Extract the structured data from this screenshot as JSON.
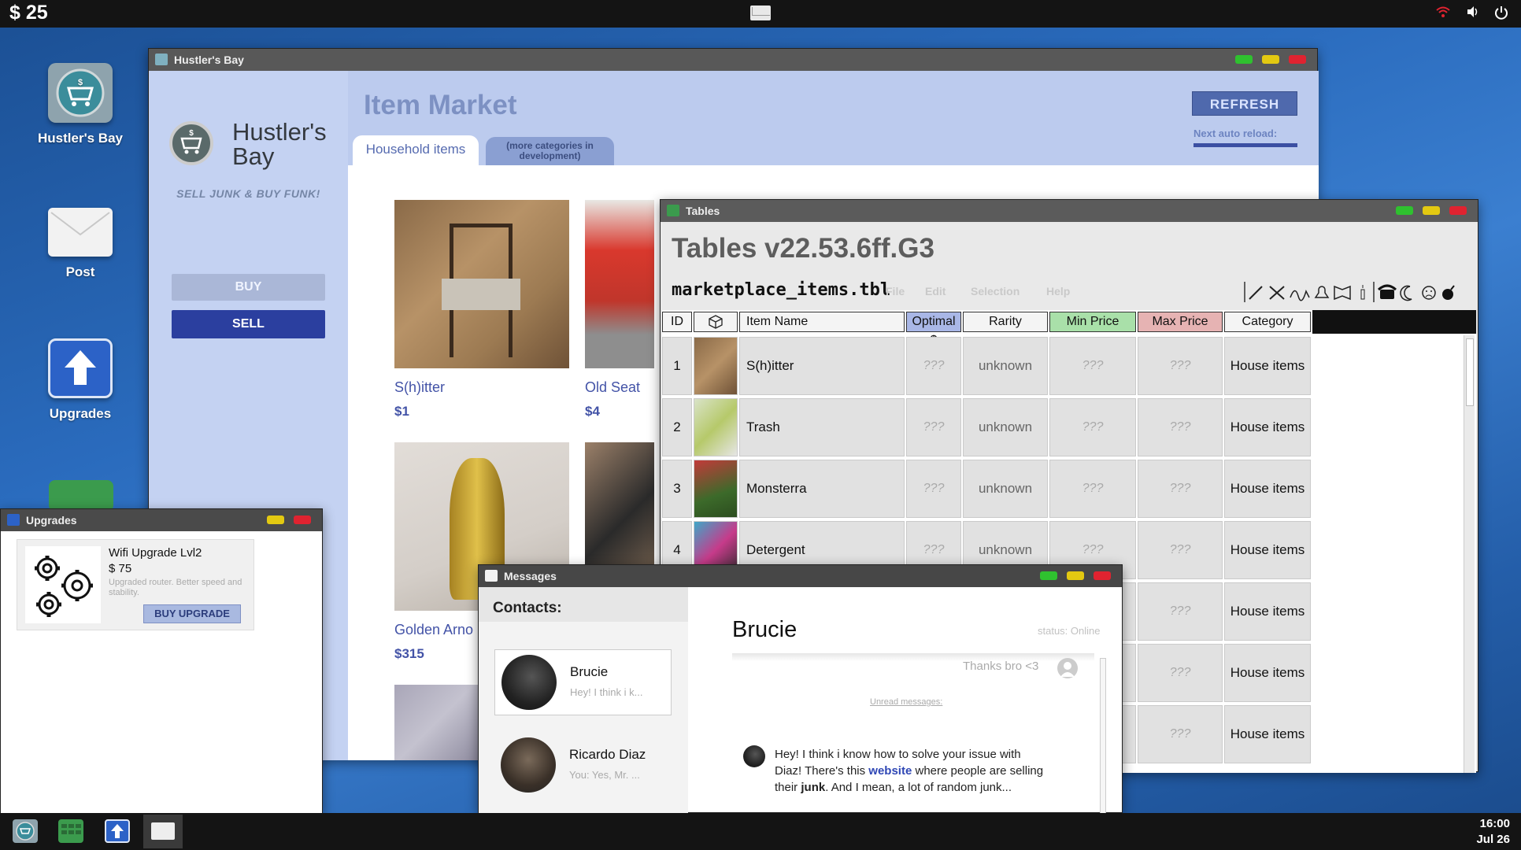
{
  "topbar": {
    "money": "$ 25",
    "icons": [
      "wifi-icon",
      "volume-icon",
      "power-icon"
    ]
  },
  "desktop": {
    "icons": [
      {
        "label": "Hustler's Bay",
        "icon": "cart-icon"
      },
      {
        "label": "Post",
        "icon": "envelope-icon"
      },
      {
        "label": "Upgrades",
        "icon": "upload-arrow-icon"
      }
    ]
  },
  "hustlers_bay": {
    "window_title": "Hustler's Bay",
    "logo_title": "Hustler's Bay",
    "slogan": "SELL JUNK & BUY FUNK!",
    "buy_label": "BUY",
    "sell_label": "SELL",
    "page_title": "Item Market",
    "tabs": [
      {
        "label": "Household items"
      },
      {
        "label": "(more categories in development)"
      }
    ],
    "refresh_label": "REFRESH",
    "next_reload_label": "Next auto reload:",
    "items": [
      {
        "name": "S(h)itter",
        "price": "$1"
      },
      {
        "name": "Old Seat",
        "price": "$4"
      },
      {
        "name": "Golden Arno",
        "price": "$315"
      }
    ]
  },
  "tables": {
    "window_title": "Tables",
    "app_title": "Tables v22.53.6ff.G3",
    "file_name": "marketplace_items.tbl",
    "menu": [
      "File",
      "Edit",
      "Selection",
      "Help"
    ],
    "columns": [
      "ID",
      "",
      "Item Name",
      "Optimal $",
      "Rarity",
      "Min Price",
      "Max Price",
      "Category"
    ],
    "header_colors": {
      "optimal": "#a9b7e6",
      "min": "#a9e0a9",
      "max": "#e6b3b3"
    },
    "rows": [
      {
        "id": "1",
        "name": "S(h)itter",
        "optimal": "???",
        "rarity": "unknown",
        "min": "???",
        "max": "???",
        "category": "House items"
      },
      {
        "id": "2",
        "name": "Trash",
        "optimal": "???",
        "rarity": "unknown",
        "min": "???",
        "max": "???",
        "category": "House items"
      },
      {
        "id": "3",
        "name": "Monsterra",
        "optimal": "???",
        "rarity": "unknown",
        "min": "???",
        "max": "???",
        "category": "House items"
      },
      {
        "id": "4",
        "name": "Detergent",
        "optimal": "???",
        "rarity": "unknown",
        "min": "???",
        "max": "???",
        "category": "House items"
      },
      {
        "id": "",
        "name": "",
        "optimal": "",
        "rarity": "",
        "min": "???",
        "max": "???",
        "category": "House items"
      },
      {
        "id": "",
        "name": "",
        "optimal": "",
        "rarity": "",
        "min": "???",
        "max": "???",
        "category": "House items"
      },
      {
        "id": "",
        "name": "",
        "optimal": "",
        "rarity": "",
        "min": "???",
        "max": "???",
        "category": "House items"
      }
    ]
  },
  "messages": {
    "window_title": "Messages",
    "contacts_label": "Contacts:",
    "contacts": [
      {
        "name": "Brucie",
        "preview": "Hey! I think i k..."
      },
      {
        "name": "Ricardo Diaz",
        "preview": "You: Yes, Mr. ..."
      }
    ],
    "chat_name": "Brucie",
    "status": "status: Online",
    "last_sent": "Thanks bro <3",
    "unread_label": "Unread messages:",
    "message_part1": "Hey! I think i know how to solve your issue with Diaz! There's this ",
    "message_link": "website",
    "message_part2": " where people are selling their ",
    "message_bold": "junk",
    "message_part3": ". And I mean, a lot of random junk..."
  },
  "upgrades": {
    "window_title": "Upgrades",
    "card": {
      "name": "Wifi Upgrade Lvl2",
      "price": "$ 75",
      "description": "Upgraded router. Better speed and stability.",
      "buy_label": "BUY UPGRADE"
    }
  },
  "taskbar": {
    "time": "16:00",
    "date": "Jul 26"
  }
}
